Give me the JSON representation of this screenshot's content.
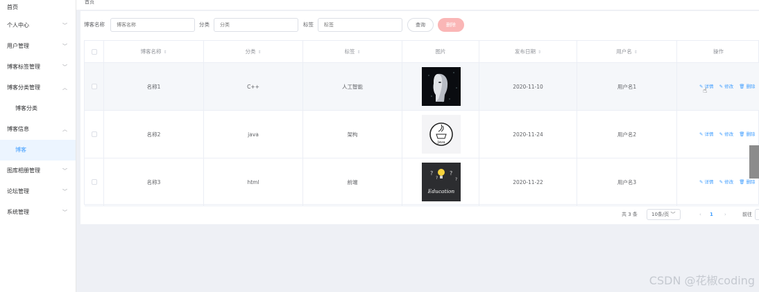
{
  "sidebar": {
    "items": [
      {
        "label": "首页"
      },
      {
        "label": "个人中心",
        "chevron": "﹀"
      },
      {
        "label": "用户管理",
        "chevron": "﹀"
      },
      {
        "label": "博客标签管理",
        "chevron": "﹀"
      },
      {
        "label": "博客分类管理",
        "chevron": "︿"
      },
      {
        "label": "博客分类"
      },
      {
        "label": "博客信息",
        "chevron": "︿"
      },
      {
        "label": "博客"
      },
      {
        "label": "图库相册管理",
        "chevron": "﹀"
      },
      {
        "label": "论坛管理",
        "chevron": "﹀"
      },
      {
        "label": "系统管理",
        "chevron": "﹀"
      }
    ]
  },
  "breadcrumb": "首页",
  "search": {
    "name_label": "博客名称",
    "name_placeholder": "博客名称",
    "category_label": "分类",
    "category_placeholder": "分类",
    "tag_label": "标签",
    "tag_placeholder": "标签",
    "query_button": "查询",
    "delete_button": "删除"
  },
  "table": {
    "headers": {
      "name": "博客名称",
      "category": "分类",
      "tag": "标签",
      "image": "图片",
      "date": "发布日期",
      "user": "用户名",
      "actions": "操作"
    },
    "sort_icon": "⇕",
    "rows": [
      {
        "name": "名称1",
        "category": "C++",
        "tag": "人工智能",
        "date": "2020-11-10",
        "user": "用户名1",
        "image_icon": "ai-face-image"
      },
      {
        "name": "名称2",
        "category": "java",
        "tag": "架构",
        "date": "2020-11-24",
        "user": "用户名2",
        "image_icon": "java-logo-image"
      },
      {
        "name": "名称3",
        "category": "html",
        "tag": "前端",
        "date": "2020-11-22",
        "user": "用户名3",
        "image_icon": "education-lightbulb-image"
      }
    ],
    "actions": {
      "detail": "详情",
      "edit": "修改",
      "delete": "删除"
    },
    "java_logo_text": "Java",
    "education_text": "Education"
  },
  "pagination": {
    "total": "共 3 条",
    "page_size": "10条/页",
    "prev": "‹",
    "current": "1",
    "next": "›",
    "goto": "前往"
  },
  "watermark": "CSDN @花椒coding",
  "colors": {
    "primary": "#409eff",
    "danger_light": "#fab6b6",
    "active_bg": "#ecf5ff"
  }
}
